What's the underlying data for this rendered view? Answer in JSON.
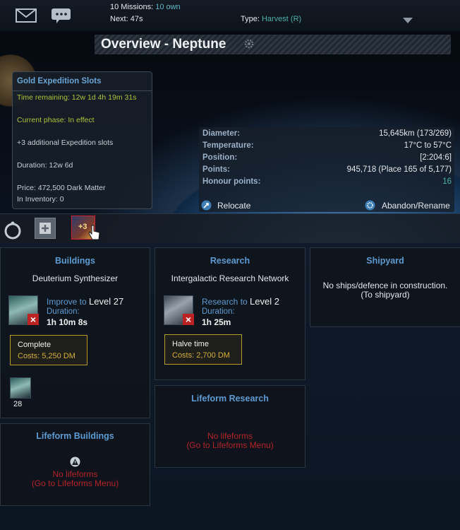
{
  "topbar": {
    "missions_label": "10 Missions:",
    "missions_own": "10 own",
    "next_label": "Next:",
    "next_value": "47s",
    "type_label": "Type:",
    "type_value": "Harvest (R)"
  },
  "overview": {
    "title": "Overview",
    "separator": "-",
    "planet_name": "Neptune"
  },
  "tooltip": {
    "title": "Gold Expedition Slots",
    "time_remaining": "Time remaining: 12w 1d 4h 19m 31s",
    "current_phase": "Current phase: In effect",
    "effect": "+3 additional Expedition slots",
    "duration": "Duration: 12w 6d",
    "price": "Price: 472,500 Dark Matter",
    "inventory": "In Inventory: 0"
  },
  "planet_info": {
    "rows": [
      {
        "label": "Diameter:",
        "value": "15,645km (173/269)"
      },
      {
        "label": "Temperature:",
        "value": "17°C to 57°C"
      },
      {
        "label": "Position:",
        "value": "[2:204:6]"
      },
      {
        "label": "Points:",
        "value": "945,718 (Place 165 of 5,177)"
      },
      {
        "label": "Honour points:",
        "value": "16"
      }
    ],
    "relocate": "Relocate",
    "abandon": "Abandon/Rename"
  },
  "toolbar": {
    "item_badge": "+3"
  },
  "buildings": {
    "title": "Buildings",
    "item": "Deuterium Synthesizer",
    "improve_prefix": "Improve to",
    "level": "Level 27",
    "duration_label": "Duration:",
    "duration_value": "1h 10m 8s",
    "button_line1": "Complete",
    "button_line2": "Costs: 5,250 DM",
    "queue_count": "28"
  },
  "research": {
    "title": "Research",
    "item": "Intergalactic Research Network",
    "research_prefix": "Research to",
    "level": "Level 2",
    "duration_label": "Duration:",
    "duration_value": "1h 25m",
    "button_line1": "Halve time",
    "button_line2": "Costs: 2,700 DM"
  },
  "shipyard": {
    "title": "Shipyard",
    "line1": "No ships/defence in construction.",
    "line2": "(To shipyard)"
  },
  "lifeform_research": {
    "title": "Lifeform Research",
    "line1": "No lifeforms",
    "line2": "(Go to Lifeforms Menu)"
  },
  "lifeform_buildings": {
    "title": "Lifeform Buildings",
    "line1": "No lifeforms",
    "line2": "(Go to Lifeforms Menu)"
  }
}
